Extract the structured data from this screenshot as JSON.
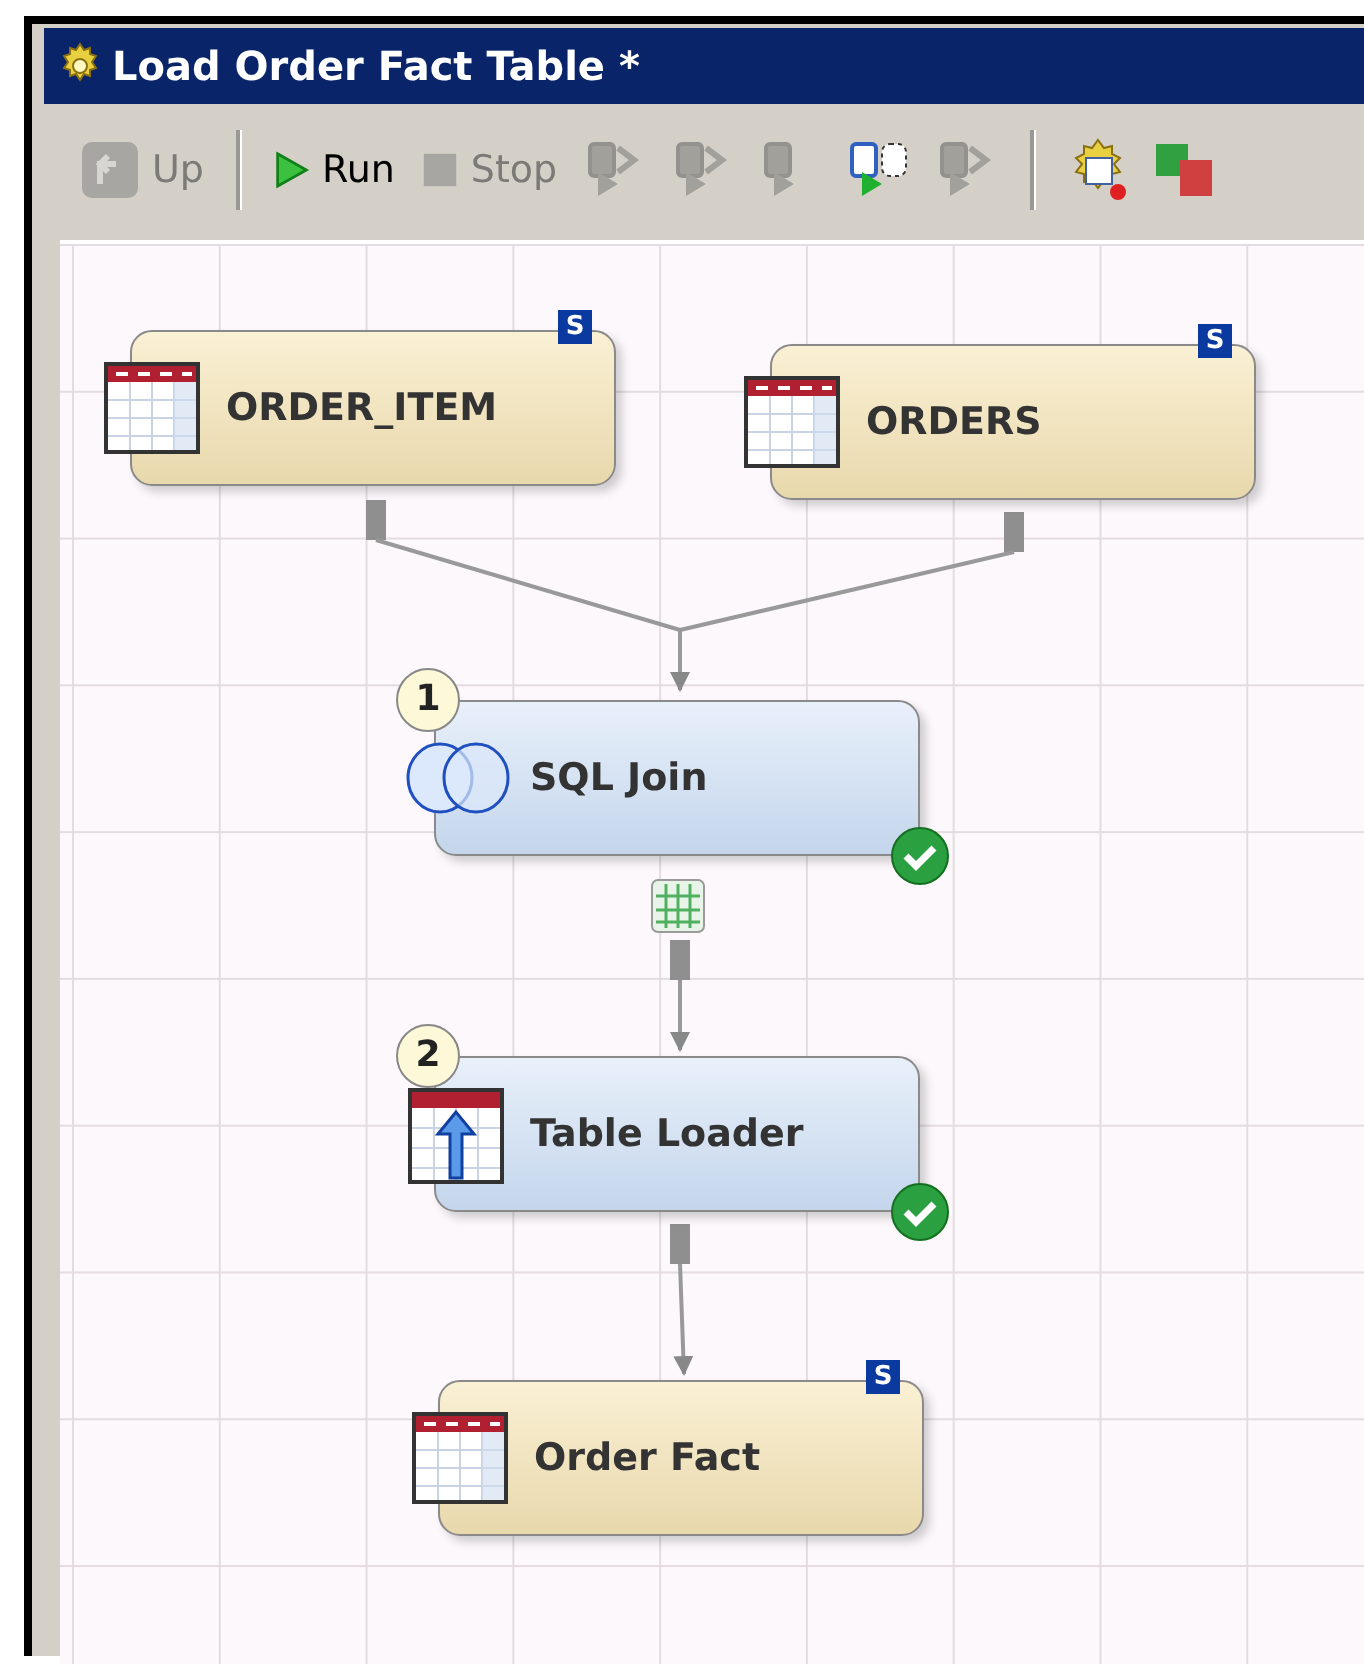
{
  "window": {
    "title": "Load Order Fact Table *"
  },
  "toolbar": [
    {
      "kind": "button",
      "label": "Up",
      "disabled": true
    },
    {
      "kind": "separator"
    },
    {
      "kind": "button",
      "label": "Run",
      "disabled": false
    },
    {
      "kind": "button",
      "label": "Stop",
      "disabled": true
    },
    {
      "kind": "icon",
      "disabled": true
    },
    {
      "kind": "icon",
      "disabled": true
    },
    {
      "kind": "icon",
      "disabled": true
    },
    {
      "kind": "icon",
      "disabled": false
    },
    {
      "kind": "icon",
      "disabled": true
    },
    {
      "kind": "separator"
    },
    {
      "kind": "icon",
      "disabled": false
    },
    {
      "kind": "icon",
      "disabled": false
    }
  ],
  "nodes": [
    {
      "kind": "table",
      "label": "ORDER_ITEM",
      "badge": "S"
    },
    {
      "kind": "table",
      "label": "ORDERS",
      "badge": "S"
    },
    {
      "kind": "join",
      "label": "SQL Join",
      "step": "1",
      "complete": true
    },
    {
      "kind": "loader",
      "label": "Table Loader",
      "step": "2",
      "complete": true
    },
    {
      "kind": "table",
      "label": "Order Fact",
      "badge": "S"
    }
  ]
}
